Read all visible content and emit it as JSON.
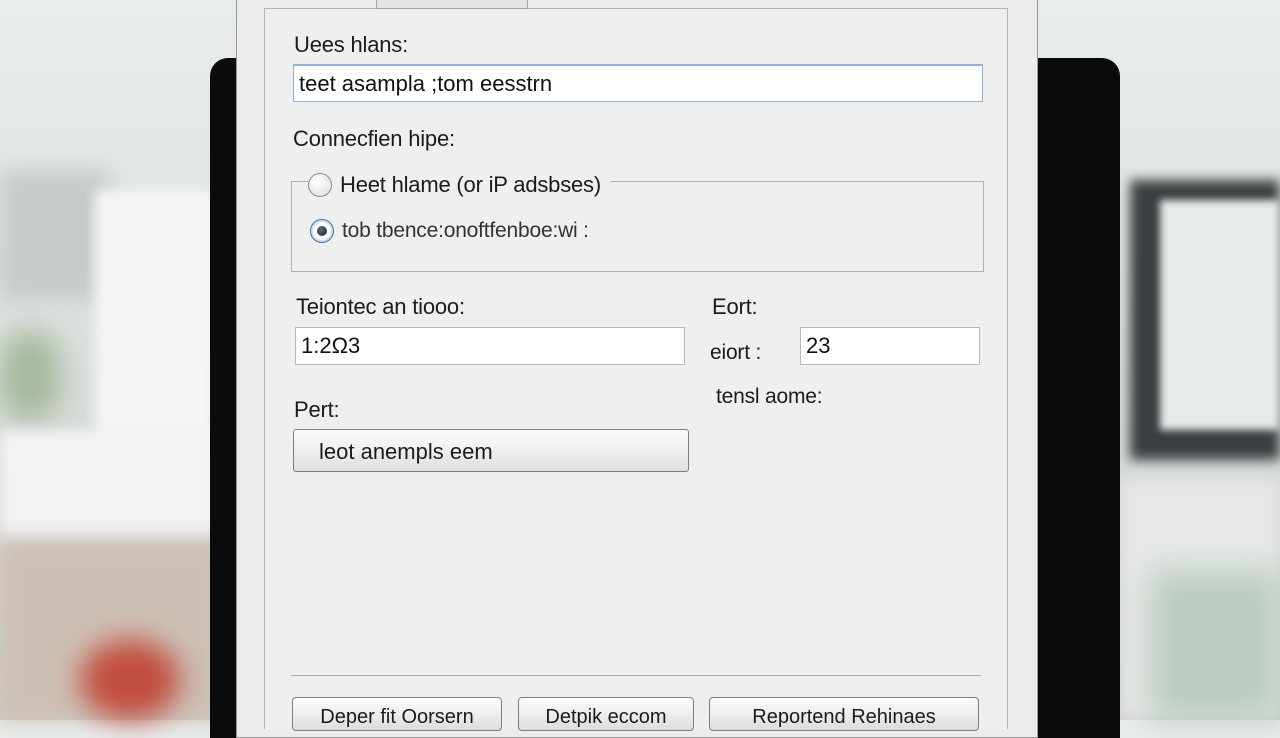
{
  "dialog": {
    "user_name_label": "Uees hlans:",
    "user_name_value": "teet asampla ;tom eesstrn",
    "connection_type_label": "Connecfien hipe:",
    "radio_host": "Heet hlame (or iP adsbses)",
    "radio_other": "tob tbence:onoftfenboe:wi :",
    "remote_label": "Teiontec an tiooo:",
    "remote_value": "1:2Ω3",
    "port_label": "Eort:",
    "port_sub_label": "eiort :",
    "port_value": "23",
    "local_label": "tensl aome:",
    "pert_label": "Pert:",
    "pert_value": "leot anempls eem",
    "buttons": [
      "Deper fit Oorsern",
      "Detpik eccom",
      "Reportend Rehinaes"
    ]
  }
}
